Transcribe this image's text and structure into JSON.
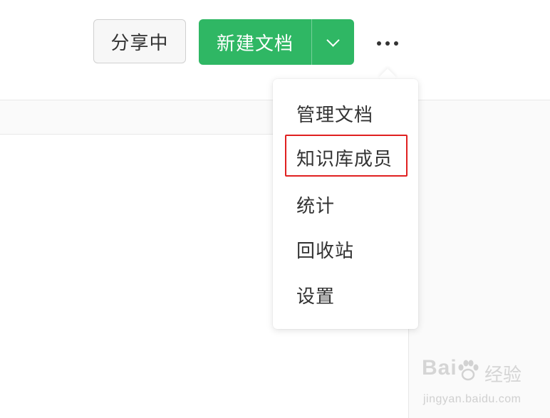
{
  "toolbar": {
    "share_label": "分享中",
    "new_doc_label": "新建文档"
  },
  "menu": {
    "items": [
      {
        "label": "管理文档"
      },
      {
        "label": "知识库成员",
        "highlighted": true
      },
      {
        "label": "统计"
      },
      {
        "label": "回收站"
      },
      {
        "label": "设置"
      }
    ]
  },
  "watermark": {
    "logo_text": "Bai",
    "logo_suffix": "经验",
    "url": "jingyan.baidu.com"
  },
  "colors": {
    "primary": "#2fb764",
    "highlight_border": "#e02020",
    "text": "#333333"
  },
  "icons": {
    "dropdown": "chevron-down-icon",
    "more": "more-dots-icon"
  }
}
